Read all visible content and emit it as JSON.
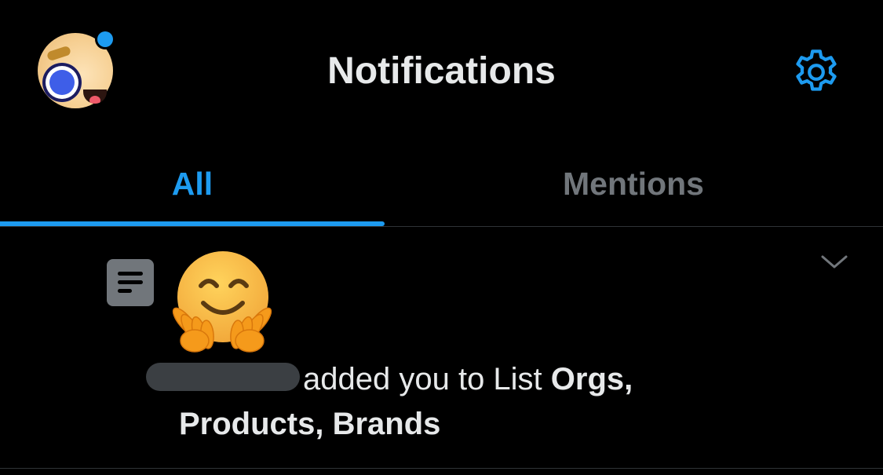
{
  "header": {
    "title": "Notifications",
    "avatar_icon": "user-avatar-icon",
    "settings_icon": "gear-icon",
    "unread_dot_color": "#1d9bf0"
  },
  "tabs": [
    {
      "label": "All",
      "selected": true
    },
    {
      "label": "Mentions",
      "selected": false
    }
  ],
  "notifications": [
    {
      "type_icon": "list-icon",
      "avatar_icon": "hugging-face-icon",
      "actor": "",
      "action_text": "added you to List ",
      "list_name": "Orgs, Products, Brands",
      "menu_icon": "chevron-down-icon"
    }
  ],
  "colors": {
    "background": "#000000",
    "accent": "#1d9bf0",
    "text_primary": "#e7e9ea",
    "text_secondary": "#71767b",
    "divider": "#2f3336"
  }
}
